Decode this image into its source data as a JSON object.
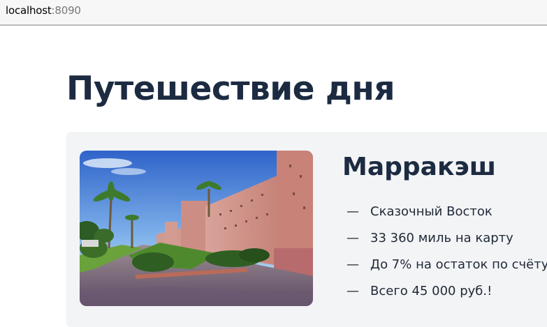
{
  "browser": {
    "url_host": "localhost",
    "url_port": ":8090"
  },
  "page": {
    "title": "Путешествие дня"
  },
  "trip": {
    "city": "Марракэш",
    "photo_icon": "marrakesh-city-wall-photo",
    "features": [
      {
        "dash": "—",
        "text": "Сказочный Восток"
      },
      {
        "dash": "—",
        "text": "33 360 миль на карту"
      },
      {
        "dash": "—",
        "text": "До 7% на остаток по счёту"
      },
      {
        "dash": "—",
        "text": "Всего 45 000 руб.!"
      }
    ]
  },
  "colors": {
    "heading": "#1c2b41",
    "card_background": "#f3f4f6"
  }
}
